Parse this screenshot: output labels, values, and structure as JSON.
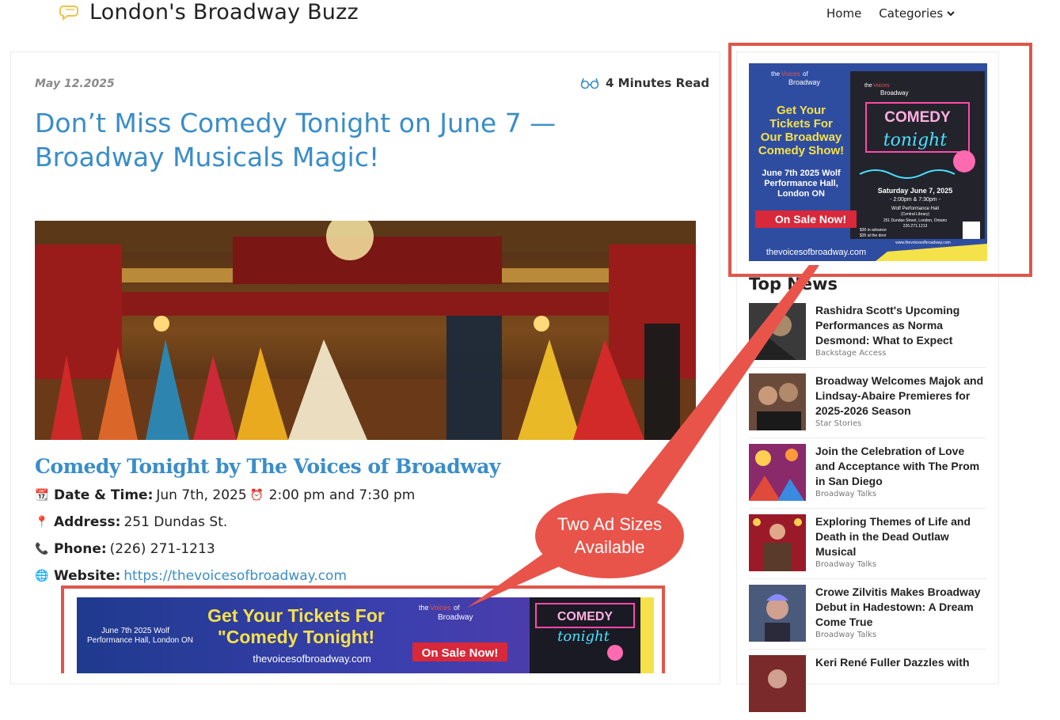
{
  "header": {
    "site_title": "London's Broadway Buzz",
    "nav": [
      {
        "label": "Home"
      },
      {
        "label": "Categories"
      }
    ]
  },
  "article": {
    "date": "May 12.2025",
    "read_time": "4 Minutes Read",
    "title": "Don’t Miss Comedy Tonight on June 7 — Broadway Musicals Magic!",
    "subtitle": "Comedy Tonight by The Voices of Broadway",
    "details": {
      "datetime_label": "Date & Time:",
      "datetime_value_1": "Jun 7th, 2025",
      "datetime_value_2": "2:00 pm and 7:30 pm",
      "address_label": "Address:",
      "address_value": "251 Dundas St.",
      "phone_label": "Phone:",
      "phone_value": "(226) 271-1213",
      "website_label": "Website:",
      "website_value": "https://thevoicesofbroadway.com"
    }
  },
  "banner_ad": {
    "date_line": "June 7th 2025 Wolf Performance Hall, London ON",
    "headline_1": "Get Your Tickets For",
    "headline_2": "\"Comedy Tonight!",
    "url": "thevoicesofbroadway.com",
    "cta": "On Sale Now!",
    "brand_1": "the",
    "brand_2": "Voices",
    "brand_3": "of",
    "brand_4": "Broadway",
    "sign_1": "COMEDY",
    "sign_2": "tonight"
  },
  "square_ad": {
    "brand_1": "the",
    "brand_2": "Voices",
    "brand_3": "of",
    "brand_4": "Broadway",
    "headline": [
      "Get Your",
      "Tickets For",
      "Our Broadway",
      "Comedy Show!"
    ],
    "date_lines": [
      "June 7th 2025 Wolf",
      "Performance Hall,",
      "London ON"
    ],
    "cta": "On Sale Now!",
    "url": "thevoicesofbroadway.com",
    "sign_1": "COMEDY",
    "sign_2": "tonight",
    "poster_date": "Saturday June 7, 2025",
    "poster_times": "- 2:00pm & 7:30pm -",
    "poster_venue": "Wolf Performance Hall",
    "poster_venue_sub": "(Central Library)",
    "poster_addr": "251 Dundas Street, London, Ontario",
    "poster_phone": "226.271.1213",
    "poster_price_1": "$30 in advance",
    "poster_price_2": "$35 at the door",
    "poster_url": "www.thevoicesofbroadway.com"
  },
  "sidebar": {
    "top_news_heading": "Top News",
    "items": [
      {
        "title": "Rashidra Scott's Upcoming Performances as Norma Desmond: What to Expect",
        "category": "Backstage Access"
      },
      {
        "title": "Broadway Welcomes Majok and Lindsay-Abaire Premieres for 2025-2026 Season",
        "category": "Star Stories"
      },
      {
        "title": "Join the Celebration of Love and Acceptance with The Prom in San Diego",
        "category": "Broadway Talks"
      },
      {
        "title": "Exploring Themes of Life and Death in the Dead Outlaw Musical",
        "category": "Broadway Talks"
      },
      {
        "title": "Crowe Zilvitis Makes Broadway Debut in Hadestown: A Dream Come True",
        "category": "Broadway Talks"
      },
      {
        "title": "Keri René Fuller Dazzles with",
        "category": ""
      }
    ]
  },
  "callout": {
    "line1": "Two Ad Sizes",
    "line2": "Available"
  },
  "colors": {
    "link_blue": "#3a8dc8",
    "annotation_red": "#e0564b",
    "ad_blue": "#2f4da0",
    "ad_yellow": "#f5e14a"
  }
}
